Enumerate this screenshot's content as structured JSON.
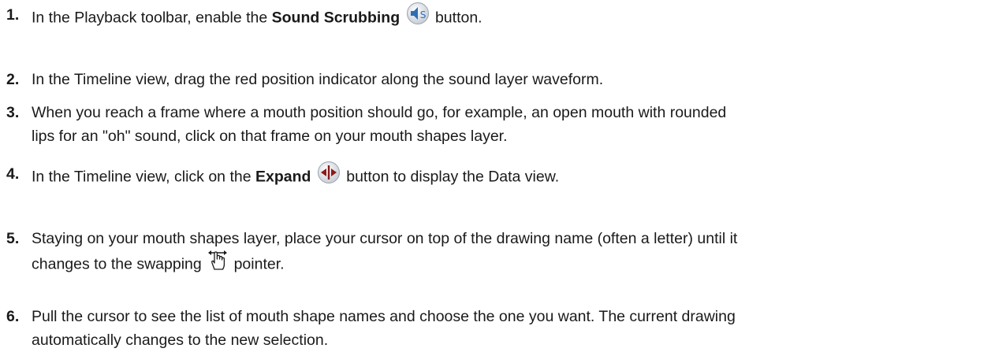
{
  "steps": [
    {
      "number": "1.",
      "before": "In the Playback toolbar, enable the ",
      "bold": "Sound Scrubbing",
      "after": " button.",
      "icon": "sound-scrubbing-icon"
    },
    {
      "number": "2.",
      "text": "In the Timeline view, drag the red position indicator along the sound layer waveform."
    },
    {
      "number": "3.",
      "line1": "When you reach a frame where a mouth position should go, for example, an open mouth with rounded",
      "line2": "lips for an \"oh\" sound, click on that frame on your mouth shapes layer."
    },
    {
      "number": "4.",
      "before": "In the Timeline view, click on the ",
      "bold": "Expand",
      "after": " button to display the Data view.",
      "icon": "expand-icon"
    },
    {
      "number": "5.",
      "line1": "Staying on your mouth shapes layer, place your cursor on top of the drawing name (often a letter) until it",
      "line2_before": "changes to the swapping ",
      "line2_after": " pointer.",
      "icon": "swap-hand-icon"
    },
    {
      "number": "6.",
      "line1": "Pull the cursor to see the list of mouth shape names and choose the one you want. The current drawing",
      "line2": "automatically changes to the new selection."
    }
  ],
  "colors": {
    "text": "#1a1a1a",
    "sound_icon_blue": "#2f6fb5",
    "expand_icon_red": "#8b1a1a"
  }
}
